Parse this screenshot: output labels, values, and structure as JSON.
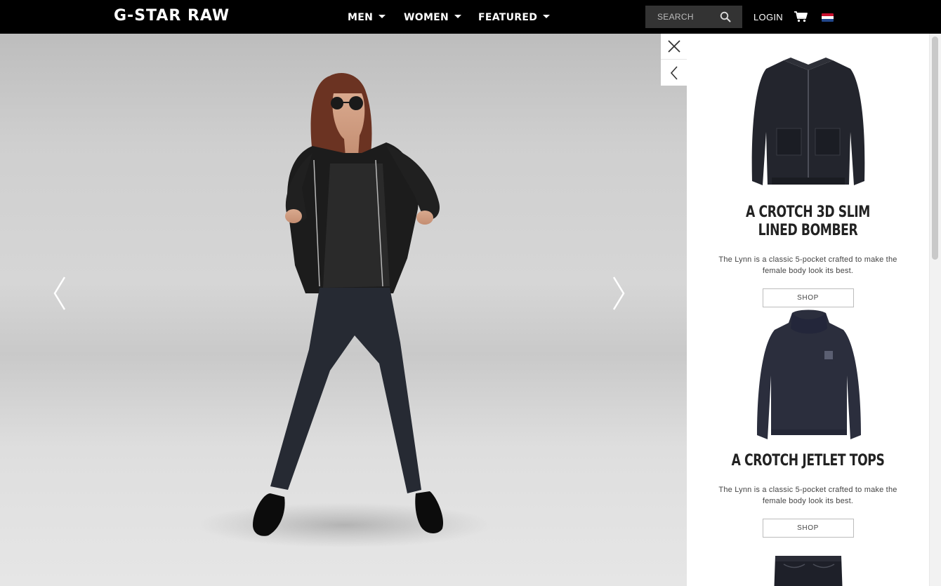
{
  "brand": {
    "logo_text": "G-STAR RAW"
  },
  "nav": {
    "items": [
      {
        "label": "MEN"
      },
      {
        "label": "WOMEN"
      },
      {
        "label": "FEATURED"
      }
    ],
    "search_placeholder": "SEARCH",
    "login_label": "LOGIN",
    "cart_icon": "cart-icon",
    "flag_icon": "netherlands-flag-icon"
  },
  "hero": {
    "prev_icon": "chevron-left-icon",
    "next_icon": "chevron-right-icon"
  },
  "panel": {
    "close_icon": "close-icon",
    "back_icon": "chevron-left-icon",
    "products": [
      {
        "title_line1": "A CROTCH 3D SLIM",
        "title_line2": "LINED BOMBER",
        "description": "The Lynn is a classic 5-pocket crafted to make the female body look its best.",
        "shop_label": "SHOP",
        "image_icon": "bomber-jacket-image"
      },
      {
        "title_line1": "A CROTCH JETLET TOPS",
        "title_line2": "",
        "description": "The Lynn is a classic 5-pocket crafted to make the female body look its best.",
        "shop_label": "SHOP",
        "image_icon": "sweater-image"
      },
      {
        "image_icon": "jeans-image"
      }
    ]
  },
  "colors": {
    "topbar": "#000000",
    "search_bg": "#333333",
    "panel_bg": "#ffffff",
    "text_dark": "#222222"
  }
}
